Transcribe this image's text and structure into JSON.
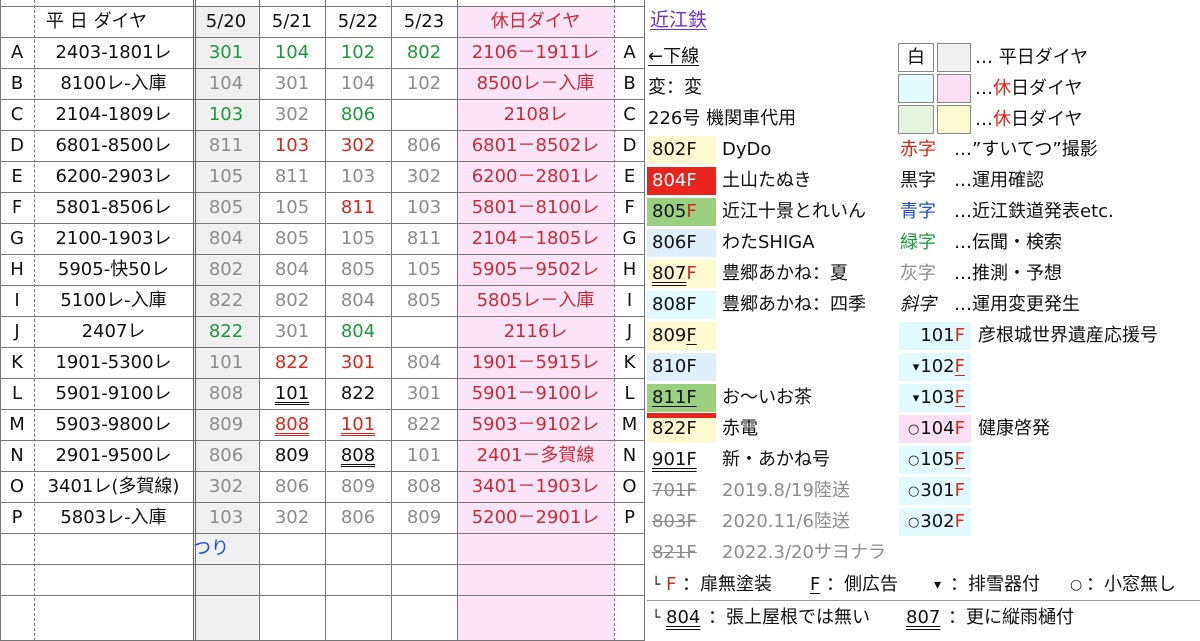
{
  "colors": {
    "green": "#1a9a3c",
    "gray": "#8c8c8c",
    "red": "#e0241b",
    "black": "#111111",
    "blue": "#1f4fd4",
    "holiday_bg": "#fce4f8",
    "holiday_text": "#cc2a36",
    "header_gray": "#f0f0f0",
    "pink_box": "#fbe0f3",
    "cyan_box": "#e2fafc",
    "yellow_box": "#fbfad0",
    "green_box": "#e6f5e0"
  },
  "table": {
    "header": {
      "weekday": "平 日 ダイヤ",
      "dates": [
        "5/20",
        "5/21",
        "5/22",
        "5/23"
      ],
      "holiday": "休日ダイヤ"
    },
    "rows": [
      {
        "id": "A",
        "train": "2403-1801レ",
        "days": [
          {
            "v": "301",
            "c": "green"
          },
          {
            "v": "104",
            "c": "green"
          },
          {
            "v": "102",
            "c": "green"
          },
          {
            "v": "802",
            "c": "green"
          }
        ],
        "holiday": "2106－1911レ"
      },
      {
        "id": "B",
        "train": "8100レ-入庫",
        "days": [
          {
            "v": "104",
            "c": "gray"
          },
          {
            "v": "301",
            "c": "gray"
          },
          {
            "v": "104",
            "c": "gray"
          },
          {
            "v": "102",
            "c": "gray"
          }
        ],
        "holiday": "8500レ－入庫"
      },
      {
        "id": "C",
        "train": "2104-1809レ",
        "days": [
          {
            "v": "103",
            "c": "green"
          },
          {
            "v": "302",
            "c": "gray"
          },
          {
            "v": "806",
            "c": "green"
          },
          {
            "v": "",
            "c": "gray"
          }
        ],
        "holiday": "2108レ"
      },
      {
        "id": "D",
        "train": "6801-8500レ",
        "days": [
          {
            "v": "811",
            "c": "gray"
          },
          {
            "v": "103",
            "c": "red"
          },
          {
            "v": "302",
            "c": "red"
          },
          {
            "v": "806",
            "c": "gray"
          }
        ],
        "holiday": "6801－8502レ"
      },
      {
        "id": "E",
        "train": "6200-2903レ",
        "days": [
          {
            "v": "105",
            "c": "gray"
          },
          {
            "v": "811",
            "c": "gray"
          },
          {
            "v": "103",
            "c": "gray"
          },
          {
            "v": "302",
            "c": "gray"
          }
        ],
        "holiday": "6200－2801レ"
      },
      {
        "id": "F",
        "train": "5801-8506レ",
        "days": [
          {
            "v": "805",
            "c": "gray"
          },
          {
            "v": "105",
            "c": "gray"
          },
          {
            "v": "811",
            "c": "red"
          },
          {
            "v": "103",
            "c": "gray"
          }
        ],
        "holiday": "5801－8100レ"
      },
      {
        "id": "G",
        "train": "2100-1903レ",
        "days": [
          {
            "v": "804",
            "c": "gray"
          },
          {
            "v": "805",
            "c": "gray"
          },
          {
            "v": "105",
            "c": "gray"
          },
          {
            "v": "811",
            "c": "gray"
          }
        ],
        "holiday": "2104－1805レ"
      },
      {
        "id": "H",
        "train": "5905-快50レ",
        "days": [
          {
            "v": "802",
            "c": "gray"
          },
          {
            "v": "804",
            "c": "gray"
          },
          {
            "v": "805",
            "c": "gray"
          },
          {
            "v": "105",
            "c": "gray"
          }
        ],
        "holiday": "5905－9502レ"
      },
      {
        "id": "I",
        "train": "5100レ-入庫",
        "days": [
          {
            "v": "822",
            "c": "gray"
          },
          {
            "v": "802",
            "c": "gray"
          },
          {
            "v": "804",
            "c": "gray"
          },
          {
            "v": "805",
            "c": "gray"
          }
        ],
        "holiday": "5805レ－入庫"
      },
      {
        "id": "J",
        "train": "2407レ",
        "days": [
          {
            "v": "822",
            "c": "green"
          },
          {
            "v": "301",
            "c": "gray"
          },
          {
            "v": "804",
            "c": "green"
          },
          {
            "v": "",
            "c": "gray"
          }
        ],
        "holiday": "2116レ"
      },
      {
        "id": "K",
        "train": "1901-5300レ",
        "days": [
          {
            "v": "101",
            "c": "gray"
          },
          {
            "v": "822",
            "c": "red"
          },
          {
            "v": "301",
            "c": "red"
          },
          {
            "v": "804",
            "c": "gray"
          }
        ],
        "holiday": "1901－5915レ"
      },
      {
        "id": "L",
        "train": "5901-9100レ",
        "days": [
          {
            "v": "808",
            "c": "gray"
          },
          {
            "v": "101",
            "c": "black",
            "u": "d"
          },
          {
            "v": "822",
            "c": "black"
          },
          {
            "v": "301",
            "c": "gray"
          }
        ],
        "holiday": "5901－9100レ"
      },
      {
        "id": "M",
        "train": "5903-9800レ",
        "days": [
          {
            "v": "809",
            "c": "gray"
          },
          {
            "v": "808",
            "c": "red",
            "u": "d"
          },
          {
            "v": "101",
            "c": "red",
            "u": "d"
          },
          {
            "v": "822",
            "c": "gray"
          }
        ],
        "holiday": "5903－9102レ"
      },
      {
        "id": "N",
        "train": "2901-9500レ",
        "days": [
          {
            "v": "806",
            "c": "gray"
          },
          {
            "v": "809",
            "c": "black"
          },
          {
            "v": "808",
            "c": "black",
            "u": "d"
          },
          {
            "v": "101",
            "c": "gray"
          }
        ],
        "holiday": "2401－多賀線"
      },
      {
        "id": "O",
        "train": "3401レ(多賀線)",
        "days": [
          {
            "v": "302",
            "c": "gray"
          },
          {
            "v": "806",
            "c": "gray"
          },
          {
            "v": "809",
            "c": "gray"
          },
          {
            "v": "808",
            "c": "gray"
          }
        ],
        "holiday": "3401－1903レ"
      },
      {
        "id": "P",
        "train": "5803レ-入庫",
        "days": [
          {
            "v": "103",
            "c": "gray"
          },
          {
            "v": "302",
            "c": "gray"
          },
          {
            "v": "806",
            "c": "gray"
          },
          {
            "v": "809",
            "c": "gray"
          }
        ],
        "holiday": "5200－2901レ"
      }
    ],
    "note": "つり"
  },
  "top_link": "近江鉄",
  "left_notes": [
    "←下線",
    "変：変",
    "226号 機関車代用"
  ],
  "cars": [
    {
      "n": "802F",
      "name": "DyDo",
      "bg": "#fbfad0"
    },
    {
      "n": "804F",
      "name": "土山たぬき",
      "bg": "#e8251c",
      "fg": "#ffffff"
    },
    {
      "n": "805F",
      "name": "近江十景とれいん",
      "bg": "#9ad07e",
      "redF": true
    },
    {
      "n": "806F",
      "name": "わたSHIGA",
      "bg": "#dff0fa"
    },
    {
      "n": "807F",
      "name": "豊郷あかね：夏",
      "bg": "#fbfad0",
      "redF": true,
      "u": "d"
    },
    {
      "n": "808F",
      "name": "豊郷あかね：四季",
      "bg": "#e2fafc"
    },
    {
      "n": "809F",
      "name": "",
      "bg": "#fbfad0",
      "uF": true
    },
    {
      "n": "810F",
      "name": "",
      "bg": "#dff0fa"
    },
    {
      "n": "811F",
      "name": "お～いお茶",
      "bg": "#9ad07e",
      "u": "s"
    },
    {
      "n": "822F",
      "name": "赤電",
      "bg": "#fbfad0",
      "bar": true
    },
    {
      "n": "901F",
      "name": "新・あかね号",
      "bg": "#ffffff",
      "u": "d"
    },
    {
      "n": "701F",
      "name": "2019.8/19陸送",
      "bg": "#ffffff",
      "old": true
    },
    {
      "n": "803F",
      "name": "2020.11/6陸送",
      "bg": "#ffffff",
      "old": true
    },
    {
      "n": "821F",
      "name": "2022.3/20サヨナラ",
      "bg": "#ffffff",
      "old": true
    }
  ],
  "legend": {
    "boxes": [
      {
        "label": "白",
        "text": "… 平日ダイヤ"
      },
      {
        "text": "… 休日ダイヤ"
      },
      {
        "text": "… 休日ダイヤ"
      }
    ],
    "colors": [
      {
        "label": "赤字",
        "c": "red",
        "text": "…”すいてつ”撮影"
      },
      {
        "label": "黒字",
        "c": "black",
        "text": "…運用確認"
      },
      {
        "label": "青字",
        "c": "blue",
        "text": "…近江鉄道発表etc."
      },
      {
        "label": "緑字",
        "c": "green",
        "text": "…伝聞・検索"
      },
      {
        "label": "灰字",
        "c": "gray",
        "text": "…推測・予想"
      },
      {
        "label": "斜字",
        "c": "black",
        "text": "…運用変更発生"
      }
    ]
  },
  "small_cars": [
    {
      "mk": "",
      "n": "101",
      "name": "彦根城世界遺産応援号"
    },
    {
      "mk": "▾",
      "n": "102"
    },
    {
      "mk": "▾",
      "n": "103"
    },
    {
      "mk": "○",
      "n": "104",
      "name": "健康啓発"
    },
    {
      "mk": "○",
      "n": "105"
    },
    {
      "mk": "○",
      "n": "301"
    },
    {
      "mk": "○",
      "n": "302"
    }
  ],
  "footnotes": {
    "row1": {
      "f1": "F",
      "t1": "：扉無塗装",
      "f2": "F",
      "t2": "：側広告",
      "m3": "▾",
      "t3": "：排雪器付",
      "m4": "○",
      "t4": "：小窓無し"
    },
    "row2": {
      "n1": "804",
      "t1": "：張上屋根では無い",
      "n2": "807",
      "t2": "：更に縦雨樋付"
    }
  }
}
